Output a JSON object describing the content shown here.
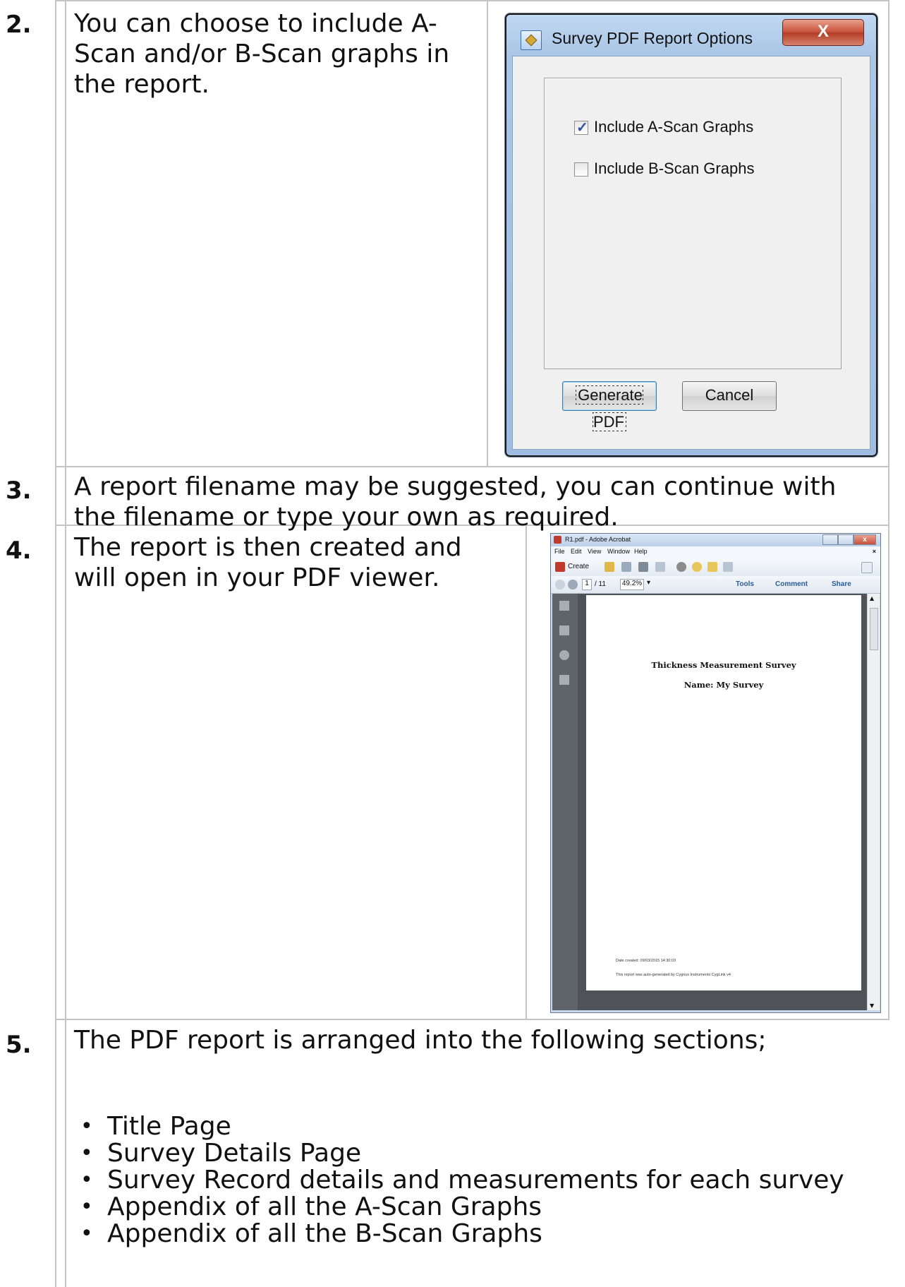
{
  "rows": [
    {
      "num": "2.",
      "lines": [
        "You can choose to include A-",
        "Scan and/or B-Scan graphs in",
        "the report."
      ]
    },
    {
      "num": "3.",
      "lines": [
        "A report filename may be suggested, you can continue with",
        "the filename or type your own as required."
      ]
    },
    {
      "num": "4.",
      "lines": [
        "The report is then created and",
        "will open in your PDF viewer."
      ]
    },
    {
      "num": "5.",
      "intro": "The PDF report is arranged into the following sections;",
      "sections": [
        "Title Page",
        "Survey Details Page",
        "Survey Record details and measurements for each survey",
        "Appendix of all the A-Scan Graphs",
        "Appendix of all the B-Scan Graphs"
      ]
    }
  ],
  "dialog": {
    "title": "Survey PDF Report Options",
    "close_label": "X",
    "checkbox_a": {
      "label": "Include A-Scan Graphs",
      "checked": true
    },
    "checkbox_b": {
      "label": "Include B-Scan Graphs",
      "checked": false
    },
    "generate_label": "Generate PDF",
    "cancel_label": "Cancel"
  },
  "acrobat": {
    "title": "R1.pdf - Adobe Acrobat",
    "menu": [
      "File",
      "Edit",
      "View",
      "Window",
      "Help"
    ],
    "create_label": "Create",
    "page_current": "1",
    "page_total": "/ 11",
    "zoom": "49.2%",
    "tools_label": "Tools",
    "comment_label": "Comment",
    "share_label": "Share",
    "page": {
      "title": "Thickness Measurement Survey",
      "name": "Name: My Survey",
      "date": "Date created: 09/03/2015 14:30:03",
      "footer": "This report was auto-generated by Cygnus Instruments CygLink v4"
    }
  }
}
